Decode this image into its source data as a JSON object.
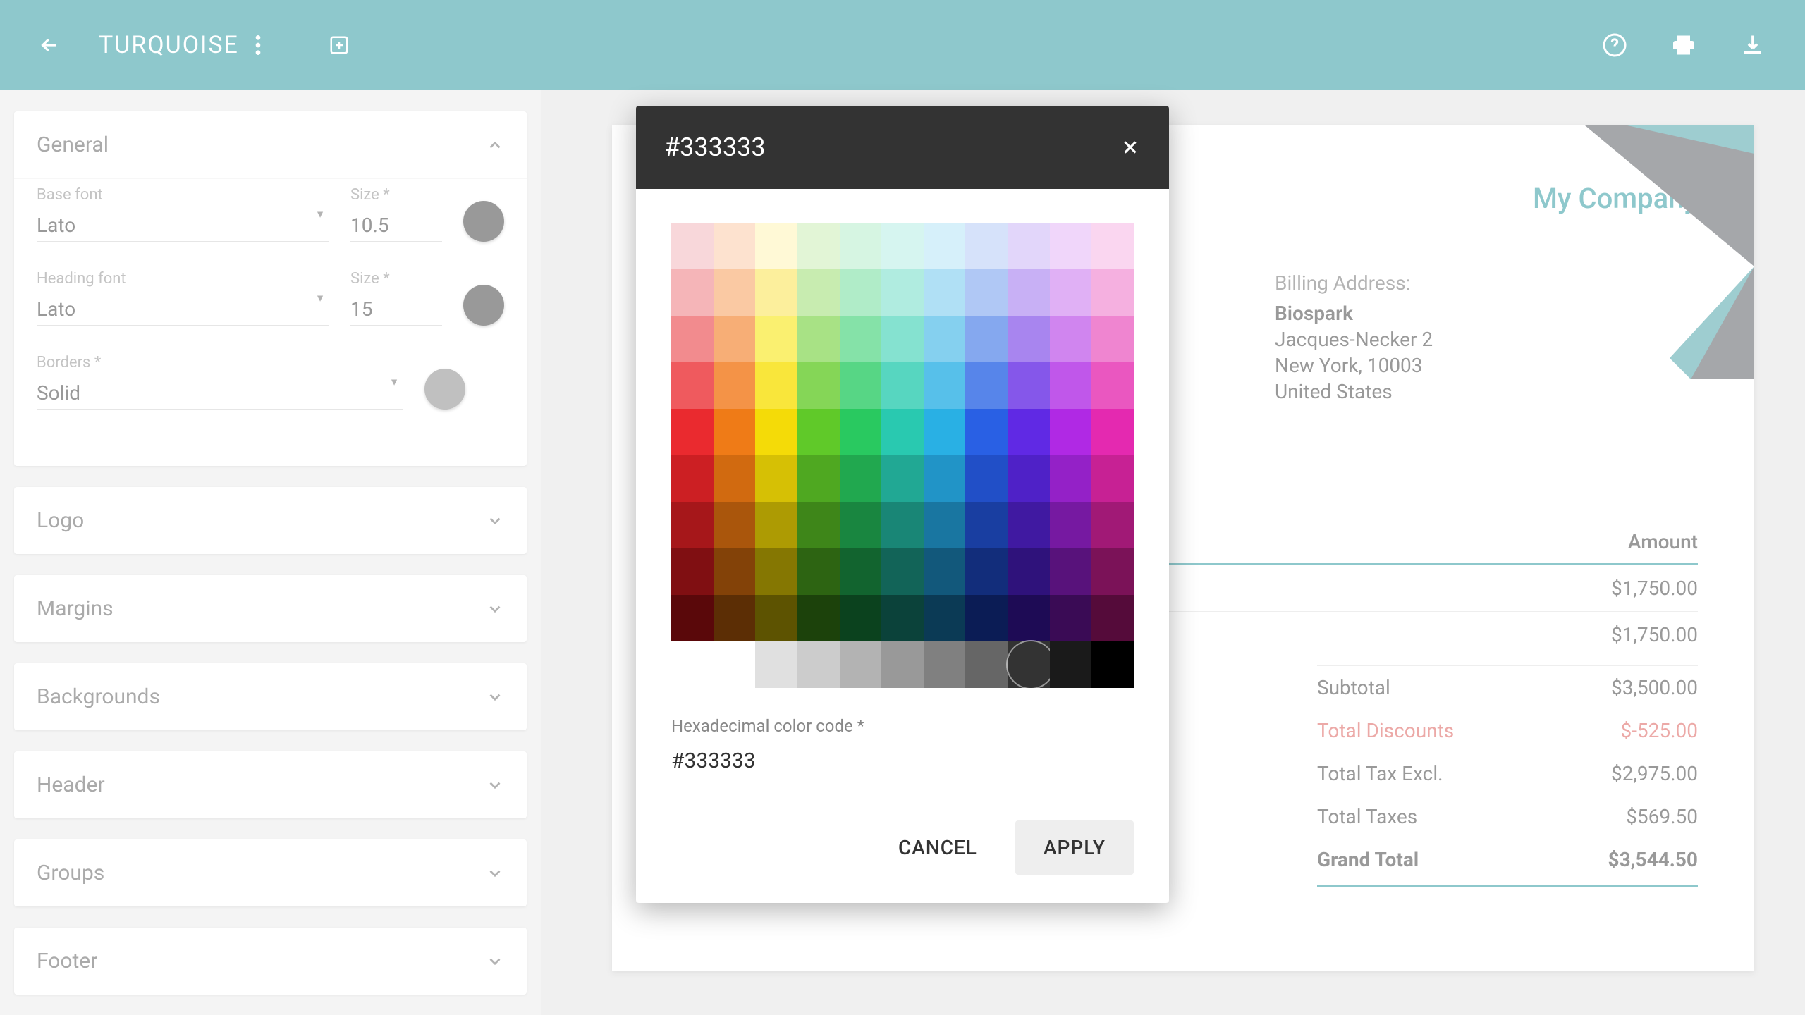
{
  "topbar": {
    "title": "TURQUOISE"
  },
  "sidebar": {
    "sections": {
      "general": "General",
      "logo": "Logo",
      "margins": "Margins",
      "backgrounds": "Backgrounds",
      "header": "Header",
      "groups": "Groups",
      "footer": "Footer"
    },
    "general": {
      "base_font_label": "Base font",
      "base_font": "Lato",
      "base_size_label": "Size *",
      "base_size": "10.5",
      "heading_font_label": "Heading font",
      "heading_font": "Lato",
      "heading_size_label": "Size *",
      "heading_size": "15",
      "borders_label": "Borders *",
      "borders": "Solid"
    }
  },
  "preview": {
    "company": "My Company",
    "billing_label": "Billing Address:",
    "billing_name": "Biospark",
    "billing_line1": "Jacques-Necker 2",
    "billing_line2": "New York, 10003",
    "billing_line3": "United States",
    "col_amount": "Amount",
    "rows": [
      {
        "amount": "$1,750.00"
      },
      {
        "amount": "$1,750.00"
      }
    ],
    "totals": [
      {
        "label": "Subtotal",
        "value": "$3,500.00",
        "class": ""
      },
      {
        "label": "Total Discounts",
        "value": "$-525.00",
        "class": "discount"
      },
      {
        "label": "Total Tax Excl.",
        "value": "$2,975.00",
        "class": ""
      },
      {
        "label": "Total Taxes",
        "value": "$569.50",
        "class": ""
      },
      {
        "label": "Grand Total",
        "value": "$3,544.50",
        "class": "grand"
      }
    ]
  },
  "dialog": {
    "title": "#333333",
    "hex_label": "Hexadecimal color code *",
    "hex_value": "#333333",
    "cancel": "CANCEL",
    "apply": "APPLY",
    "palette": [
      [
        "#f8d7da",
        "#fde2cf",
        "#fff9d6",
        "#e2f5d6",
        "#d6f5e2",
        "#d6f5f0",
        "#d6f0fa",
        "#d6e2fa",
        "#e2d6fa",
        "#f0d6fa",
        "#fad6f0"
      ],
      [
        "#f5b5b8",
        "#fac9a3",
        "#fcef9c",
        "#c8ecb0",
        "#b0ecc8",
        "#b0ece0",
        "#b0e0f5",
        "#b0c8f5",
        "#c8b0f5",
        "#e0b0f5",
        "#f5b0e0"
      ],
      [
        "#f28b8e",
        "#f7ae76",
        "#faf070",
        "#a8e285",
        "#85e2a8",
        "#85e2d0",
        "#85d0ef",
        "#85a8ef",
        "#a885ef",
        "#d085ef",
        "#ef85d0"
      ],
      [
        "#ef5a5e",
        "#f49347",
        "#f9e63b",
        "#85d657",
        "#57d685",
        "#57d6c0",
        "#57c0ea",
        "#5785ea",
        "#8557ea",
        "#c057ea",
        "#ea57c0"
      ],
      [
        "#ea2a2f",
        "#ef7b17",
        "#f4db08",
        "#60c929",
        "#29c960",
        "#29c9b0",
        "#29b0e4",
        "#2960e4",
        "#6029e4",
        "#b029e4",
        "#e429b0"
      ],
      [
        "#cc1f23",
        "#d16a10",
        "#d6c005",
        "#4fa821",
        "#21a84f",
        "#21a894",
        "#2194c7",
        "#214fc7",
        "#4f21c7",
        "#9421c7",
        "#c72194"
      ],
      [
        "#a6171a",
        "#aa560c",
        "#ad9b03",
        "#3e8619",
        "#198640",
        "#198676",
        "#1976a1",
        "#193ea1",
        "#4019a1",
        "#7619a1",
        "#a11976"
      ],
      [
        "#800f12",
        "#834208",
        "#857702",
        "#2d6412",
        "#12642f",
        "#126458",
        "#12587b",
        "#122d7b",
        "#2f127b",
        "#58127b",
        "#7b1258"
      ],
      [
        "#5a080a",
        "#5c2e05",
        "#5d5301",
        "#1c420b",
        "#0b421e",
        "#0b423a",
        "#0b3a55",
        "#0b1c55",
        "#1e0b55",
        "#3a0b55",
        "#550b3a"
      ]
    ],
    "greys": [
      "#ffffff",
      "#e0e0e0",
      "#cccccc",
      "#b3b3b3",
      "#999999",
      "#808080",
      "#666666",
      "#333333",
      "#1a1a1a",
      "#000000"
    ],
    "selected_grey_index": 7
  }
}
